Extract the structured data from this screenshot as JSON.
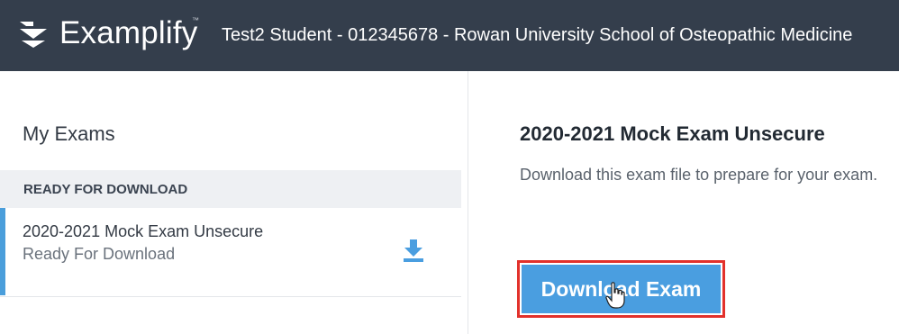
{
  "header": {
    "brand": "Examplify",
    "trademark": "™",
    "user_info": "Test2 Student - 012345678 - Rowan University School of Osteopathic Medicine",
    "bg_color": "#343e4c"
  },
  "sidebar": {
    "title": "My Exams",
    "section_header": "READY FOR DOWNLOAD",
    "items": [
      {
        "name": "2020-2021 Mock Exam Unsecure",
        "status": "Ready For Download",
        "icon": "download-icon"
      }
    ]
  },
  "detail": {
    "title": "2020-2021 Mock Exam Unsecure",
    "description": "Download this exam file to prepare for your exam.",
    "button_label": "Download Exam",
    "accent_color": "#4a9ee0",
    "highlight_color": "#e2312b"
  }
}
